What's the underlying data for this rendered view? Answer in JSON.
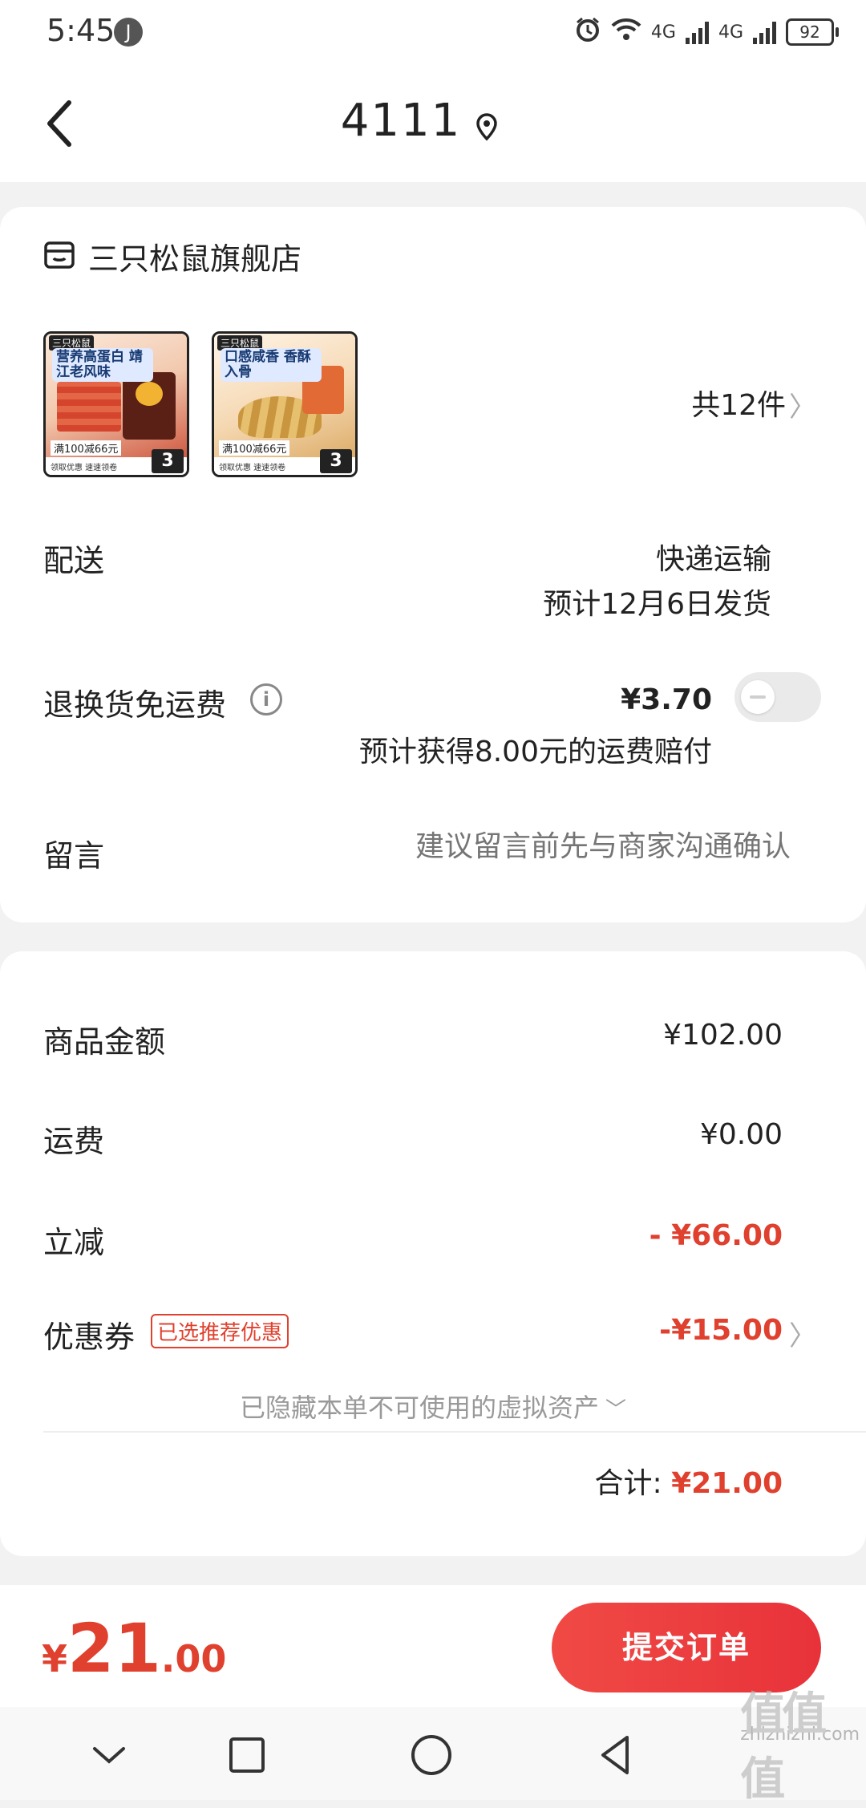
{
  "status_bar": {
    "time": "5:45",
    "app_icon": "J",
    "network_a": "4G",
    "network_b": "4G",
    "battery": "92"
  },
  "header": {
    "title": "4111"
  },
  "store": {
    "name": "三只松鼠旗舰店"
  },
  "products": [
    {
      "brand": "三只松鼠",
      "caption": "营养高蛋白 靖江老风味",
      "promo": "满100减66元",
      "quantity_badge": "3",
      "footer": "领取优惠 速速领卷"
    },
    {
      "brand": "三只松鼠",
      "caption": "口感咸香 香酥入骨",
      "promo": "满100减66元",
      "quantity_badge": "3",
      "footer": "领取优惠 速速领卷"
    }
  ],
  "item_count": "共12件",
  "delivery": {
    "label": "配送",
    "method": "快递运输",
    "estimate": "预计12月6日发货"
  },
  "return_shipping": {
    "label": "退换货免运费",
    "price": "¥3.70",
    "note": "预计获得8.00元的运费赔付",
    "toggle_on": false
  },
  "message": {
    "label": "留言",
    "placeholder": "建议留言前先与商家沟通确认"
  },
  "pricing": {
    "subtotal_label": "商品金额",
    "subtotal_value": "¥102.00",
    "shipping_label": "运费",
    "shipping_value": "¥0.00",
    "discount_label": "立减",
    "discount_value": "- ¥66.00",
    "coupon_label": "优惠券",
    "coupon_badge": "已选推荐优惠",
    "coupon_value": "-¥15.00",
    "hidden_assets": "已隐藏本单不可使用的虚拟资产",
    "total_label": "合计:",
    "total_value": "¥21.00"
  },
  "bottom_bar": {
    "currency": "¥",
    "amount_int": "21",
    "amount_dec": ".00",
    "submit_label": "提交订单"
  },
  "watermark": {
    "text": "zhizhizhi.com",
    "logo": "值值值"
  },
  "colors": {
    "accent": "#e0402e",
    "submit_button": "#e8323a"
  }
}
